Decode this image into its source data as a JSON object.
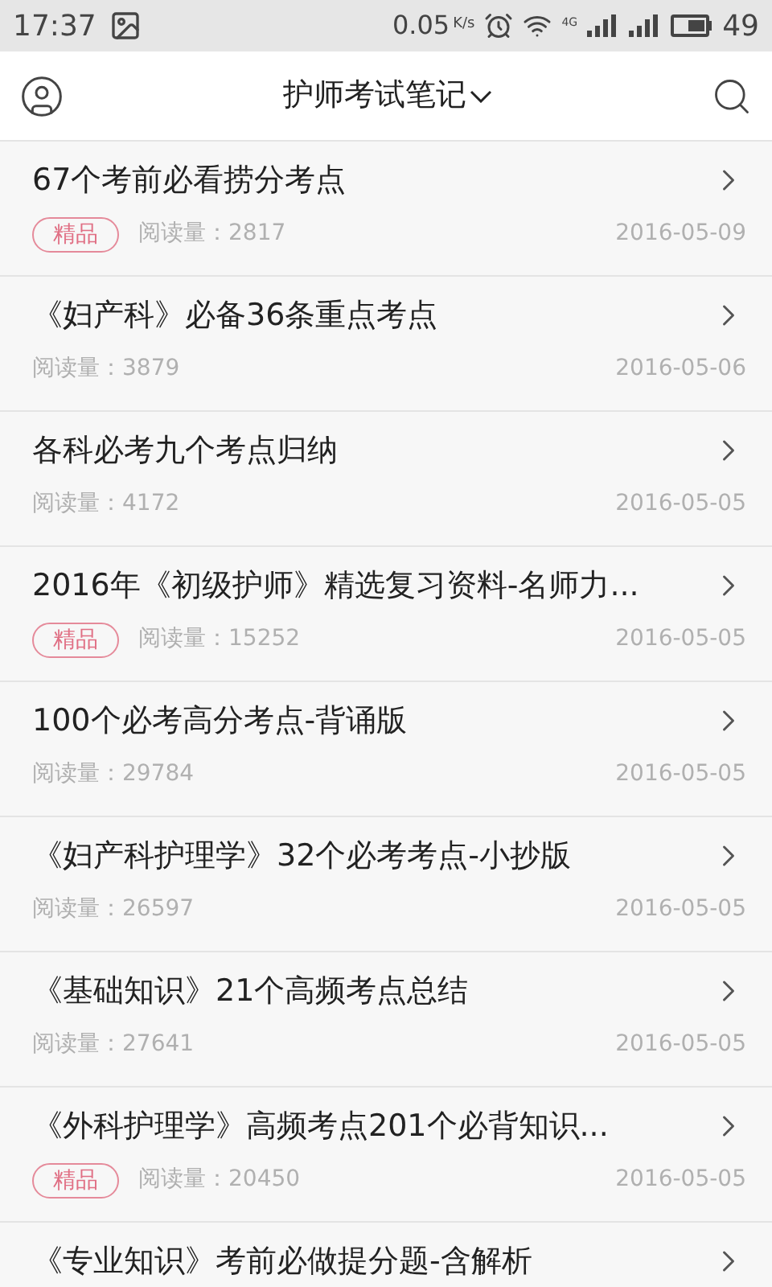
{
  "status_bar": {
    "time": "17:37",
    "speed": "0.05",
    "speed_unit": "K/s",
    "network": "4G",
    "battery": "49"
  },
  "header": {
    "title": "护师考试笔记"
  },
  "articles": [
    {
      "title": "67个考前必看捞分考点",
      "badge": "精品",
      "reads": "阅读量：2817",
      "date": "2016-05-09"
    },
    {
      "title": "《妇产科》必备36条重点考点",
      "reads": "阅读量：3879",
      "date": "2016-05-06"
    },
    {
      "title": "各科必考九个考点归纳",
      "reads": "阅读量：4172",
      "date": "2016-05-05"
    },
    {
      "title": "2016年《初级护师》精选复习资料-名师力...",
      "badge": "精品",
      "reads": "阅读量：15252",
      "date": "2016-05-05"
    },
    {
      "title": "100个必考高分考点-背诵版",
      "reads": "阅读量：29784",
      "date": "2016-05-05"
    },
    {
      "title": "《妇产科护理学》32个必考考点-小抄版",
      "reads": "阅读量：26597",
      "date": "2016-05-05"
    },
    {
      "title": "《基础知识》21个高频考点总结",
      "reads": "阅读量：27641",
      "date": "2016-05-05"
    },
    {
      "title": "《外科护理学》高频考点201个必背知识...",
      "badge": "精品",
      "reads": "阅读量：20450",
      "date": "2016-05-05"
    },
    {
      "title": "《专业知识》考前必做提分题-含解析"
    }
  ]
}
